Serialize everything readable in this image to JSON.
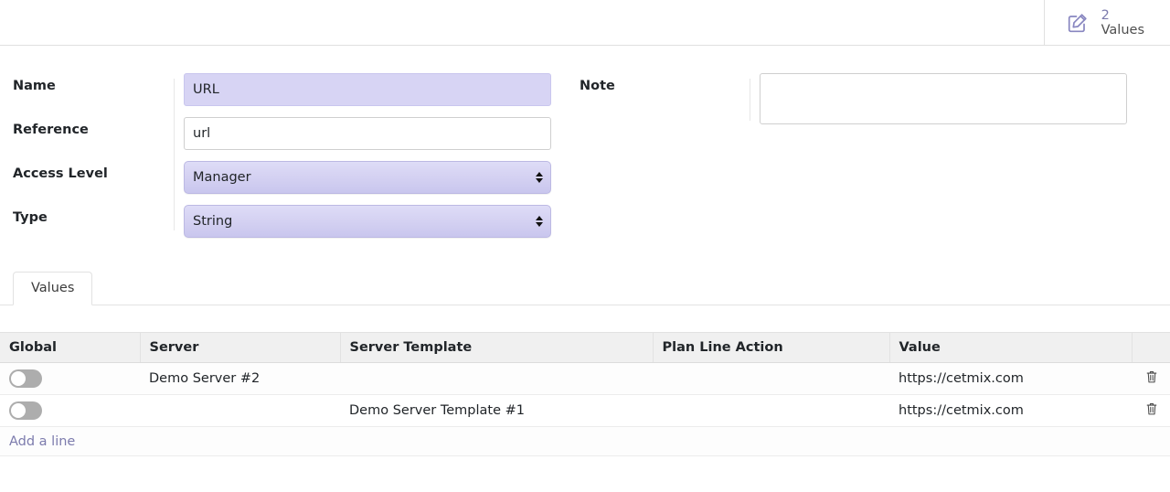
{
  "header": {
    "stat": {
      "icon": "edit-pencil-square-icon",
      "value": "2",
      "label": "Values"
    }
  },
  "form": {
    "left_fields": [
      {
        "label": "Name",
        "value": "URL",
        "type": "text-filled"
      },
      {
        "label": "Reference",
        "value": "url",
        "type": "text"
      },
      {
        "label": "Access Level",
        "value": "Manager",
        "type": "select"
      },
      {
        "label": "Type",
        "value": "String",
        "type": "select"
      }
    ],
    "right_fields": [
      {
        "label": "Note",
        "value": "",
        "type": "textarea"
      }
    ]
  },
  "tabs": [
    {
      "label": "Values",
      "active": true
    }
  ],
  "table": {
    "columns": [
      "Global",
      "Server",
      "Server Template",
      "Plan Line Action",
      "Value",
      ""
    ],
    "rows": [
      {
        "global": false,
        "server": "Demo Server #2",
        "server_template": "",
        "plan_line_action": "",
        "value": "https://cetmix.com",
        "delete_icon": "trash-icon"
      },
      {
        "global": false,
        "server": "",
        "server_template": "Demo Server Template #1",
        "plan_line_action": "",
        "value": "https://cetmix.com",
        "delete_icon": "trash-icon"
      }
    ],
    "add_line_label": "Add a line"
  },
  "colors": {
    "accent_purple": "#7c7bad",
    "field_fill": "#d7d4f4",
    "header_gray": "#f0f0f0",
    "toggle_off": "#adadad"
  }
}
